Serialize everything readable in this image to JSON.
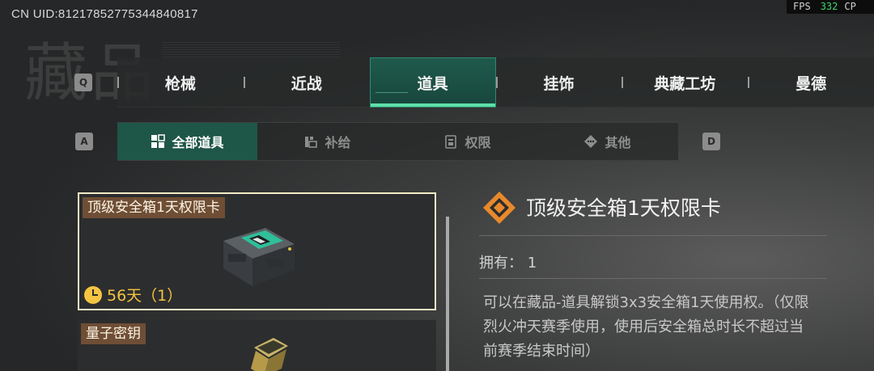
{
  "hud": {
    "uid": "CN UID:812178527753448408​17",
    "fps_label": "FPS",
    "fps_value": "332",
    "extra_label": "CP"
  },
  "page_title": "藏品",
  "hotkeys": {
    "main_prev": "Q",
    "sub_prev": "A",
    "sub_next": "D"
  },
  "main_tabs": [
    {
      "label": "枪械"
    },
    {
      "label": "近战"
    },
    {
      "label": "道具",
      "active": true
    },
    {
      "label": "挂饰"
    },
    {
      "label": "典藏工坊"
    },
    {
      "label": "曼德"
    }
  ],
  "sub_tabs": [
    {
      "label": "全部道具",
      "icon": "grid-icon",
      "active": true
    },
    {
      "label": "补给",
      "icon": "supply-icon"
    },
    {
      "label": "权限",
      "icon": "card-icon"
    },
    {
      "label": "其他",
      "icon": "diamond-icon"
    }
  ],
  "items": [
    {
      "title": "顶级安全箱1天权限卡",
      "timer": "56天（1）",
      "icon": "secure-case-image",
      "selected": true
    },
    {
      "title": "量子密钥",
      "icon": "quantum-key-image"
    }
  ],
  "detail": {
    "title": "顶级安全箱1天权限卡",
    "owned_label": "拥有：",
    "owned_value": "1",
    "description": "可以在藏品-道具解锁3x3安全箱1天使用权。（仅限烈火冲天赛季使用，使用后安全箱总时长不超过当前赛季结束时间）",
    "rarity_color": "#e8892b"
  },
  "colors": {
    "accent": "#5ee0a8",
    "active_tab_bg": "#1e5647",
    "timer": "#f4c542"
  }
}
